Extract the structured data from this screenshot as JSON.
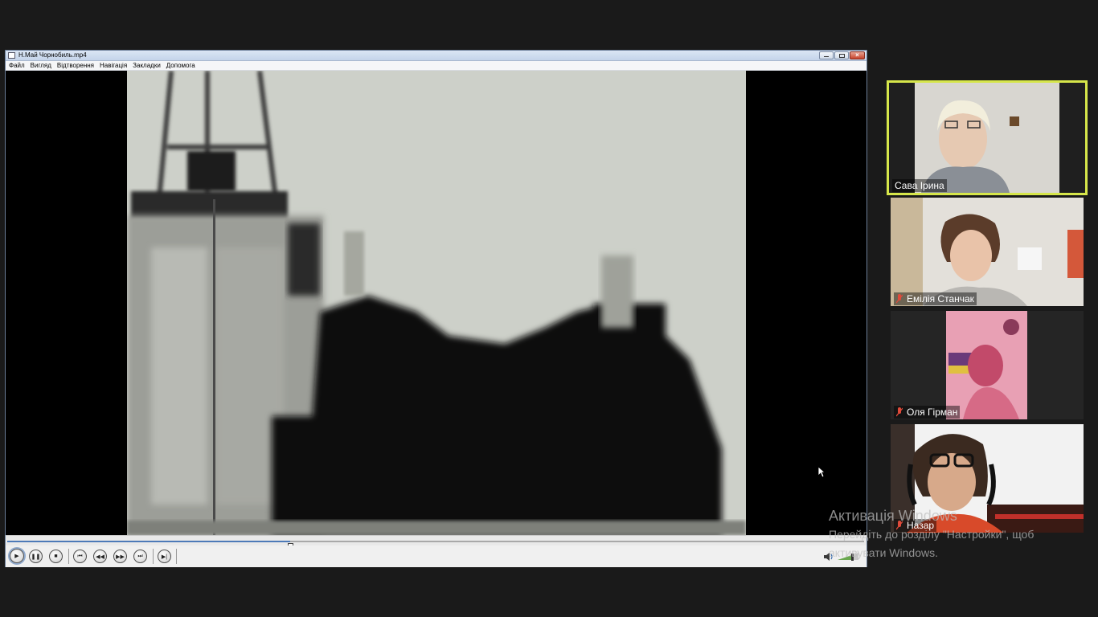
{
  "player": {
    "title": "Н.Май Чорнобиль.mp4",
    "menu": [
      "Файл",
      "Вигляд",
      "Відтворення",
      "Навігація",
      "Закладки",
      "Допомога"
    ],
    "window_buttons": [
      "minimize-icon",
      "restore-icon",
      "close-icon"
    ],
    "close_glyph": "×",
    "seek_progress": 0.33,
    "controls": [
      "play",
      "pause",
      "stop",
      "previous",
      "rewind",
      "fast-forward",
      "next",
      "frame-step"
    ],
    "control_glyphs": {
      "play": "▶",
      "pause": "❚❚",
      "stop": "■",
      "previous": "⏮",
      "rewind": "◀◀",
      "fast_forward": "▶▶",
      "next": "⏭",
      "frame_step": "▶|"
    }
  },
  "participants": [
    {
      "name": "Сава Ірина",
      "active": true,
      "muted": false
    },
    {
      "name": "Емілія Станчак",
      "active": false,
      "muted": true
    },
    {
      "name": "Оля Гірман",
      "active": false,
      "muted": true
    },
    {
      "name": "Назар",
      "active": false,
      "muted": true
    }
  ],
  "watermark": {
    "title": "Активація Windows",
    "line1": "Перейдіть до розділу \"Настройки\", щоб",
    "line2": "активувати Windows."
  },
  "colors": {
    "active_speaker_border": "#d6e64a",
    "background": "#1a1a1a",
    "mic_muted": "#e04a3a"
  }
}
